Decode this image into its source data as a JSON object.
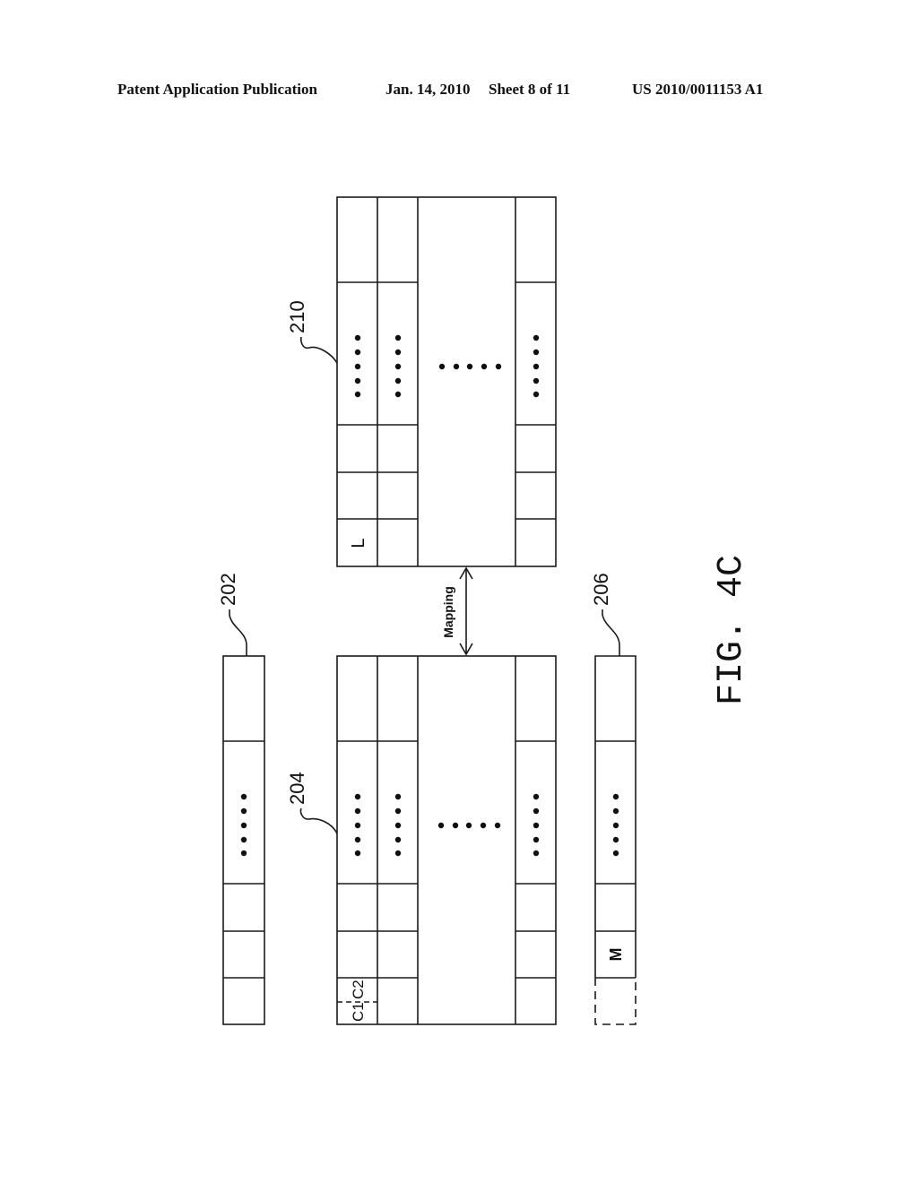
{
  "header": {
    "publication": "Patent Application Publication",
    "date": "Jan. 14, 2010",
    "sheet": "Sheet 8 of 11",
    "patent_number": "US 2010/0011153 A1"
  },
  "figure": {
    "caption": "FIG. 4C",
    "mapping_label": "Mapping",
    "ellipsis": "•••••",
    "blocks": {
      "b210": {
        "ref": "210",
        "cell_label": "L"
      },
      "b204": {
        "ref": "204",
        "cell_label_1": "C1",
        "cell_label_2": "C2"
      },
      "b202": {
        "ref": "202"
      },
      "b206": {
        "ref": "206",
        "cell_label": "M"
      }
    }
  }
}
